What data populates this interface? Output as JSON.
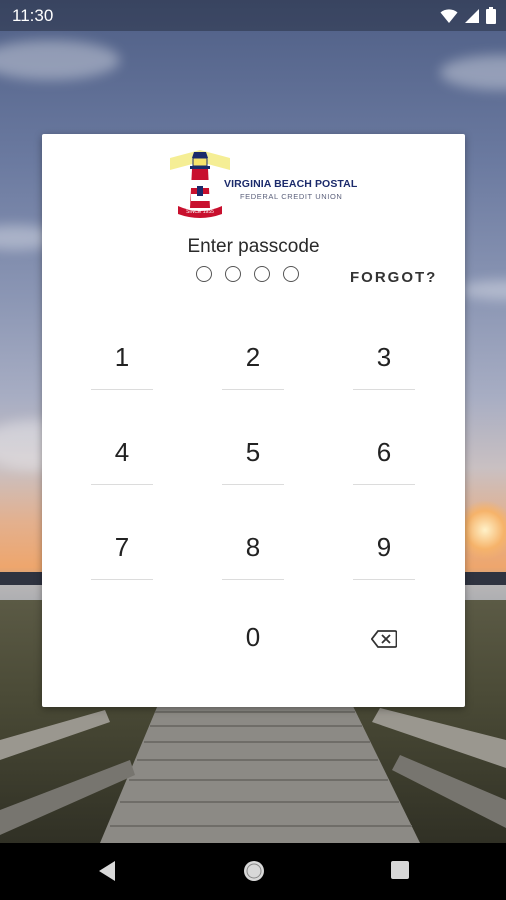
{
  "status_bar": {
    "time": "11:30"
  },
  "logo": {
    "line1": "VIRGINIA BEACH POSTAL",
    "line2": "FEDERAL CREDIT UNION",
    "ribbon": "SINCE 1955"
  },
  "passcode": {
    "prompt": "Enter passcode",
    "forgot_label": "FORGOT?",
    "digits_entered": 0,
    "length": 4
  },
  "keypad": {
    "k1": "1",
    "k2": "2",
    "k3": "3",
    "k4": "4",
    "k5": "5",
    "k6": "6",
    "k7": "7",
    "k8": "8",
    "k9": "9",
    "k0": "0",
    "backspace_icon": "backspace-icon"
  },
  "nav": {
    "back_icon": "back-icon",
    "home_icon": "home-icon",
    "recents_icon": "recents-icon"
  },
  "colors": {
    "brand_navy": "#1b2a6b",
    "brand_red": "#c8102e",
    "card": "#ffffff"
  }
}
